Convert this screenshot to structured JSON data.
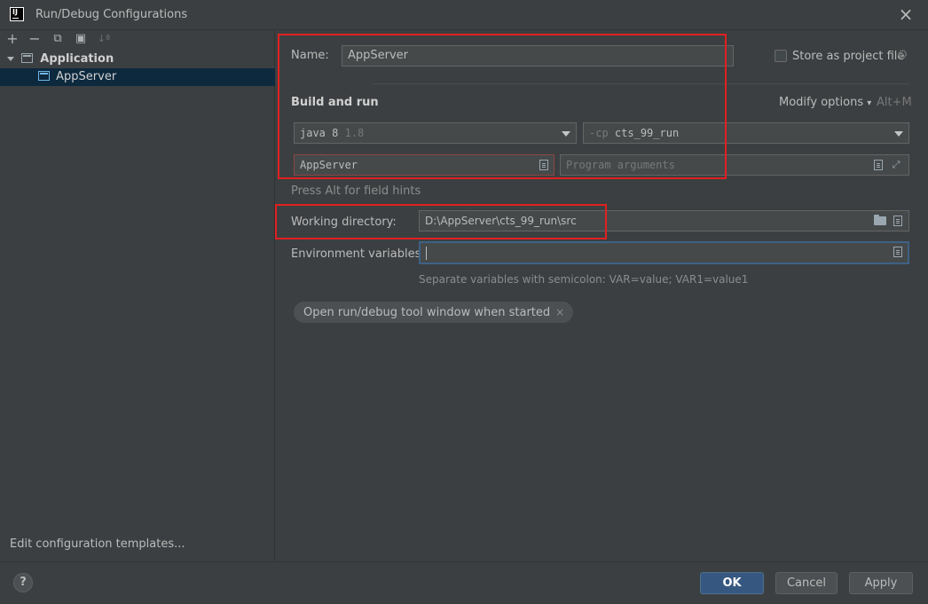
{
  "window": {
    "title": "Run/Debug Configurations",
    "app_icon_text": "IJ"
  },
  "toolbar": {
    "add": "+",
    "remove": "−",
    "copy": "⧉",
    "folder": "▣",
    "sort": "↓ª"
  },
  "tree": {
    "group": "Application",
    "item": "AppServer"
  },
  "left_footer": {
    "templates_link": "Edit configuration templates..."
  },
  "form": {
    "name_label": "Name:",
    "name_value": "AppServer",
    "store_label": "Store as project file",
    "section_title": "Build and run",
    "modify_options": "Modify options",
    "modify_shortcut": "Alt+M",
    "jdk_value": "java 8",
    "jdk_version": "1.8",
    "cp_prefix": "-cp",
    "cp_value": "cts_99_run",
    "main_class": "AppServer",
    "program_args_placeholder": "Program arguments",
    "hint": "Press Alt for field hints",
    "workdir_label": "Working directory:",
    "workdir_value": "D:\\AppServer\\cts_99_run\\src",
    "env_label": "Environment variables:",
    "env_value": "",
    "env_hint": "Separate variables with semicolon: VAR=value; VAR1=value1",
    "chip_label": "Open run/debug tool window when started",
    "chip_close": "×"
  },
  "buttons": {
    "help": "?",
    "ok": "OK",
    "cancel": "Cancel",
    "apply": "Apply"
  },
  "colors": {
    "accent": "#589df6",
    "primary_button": "#365880",
    "highlight": "#e02020",
    "selection": "#0d293e"
  }
}
